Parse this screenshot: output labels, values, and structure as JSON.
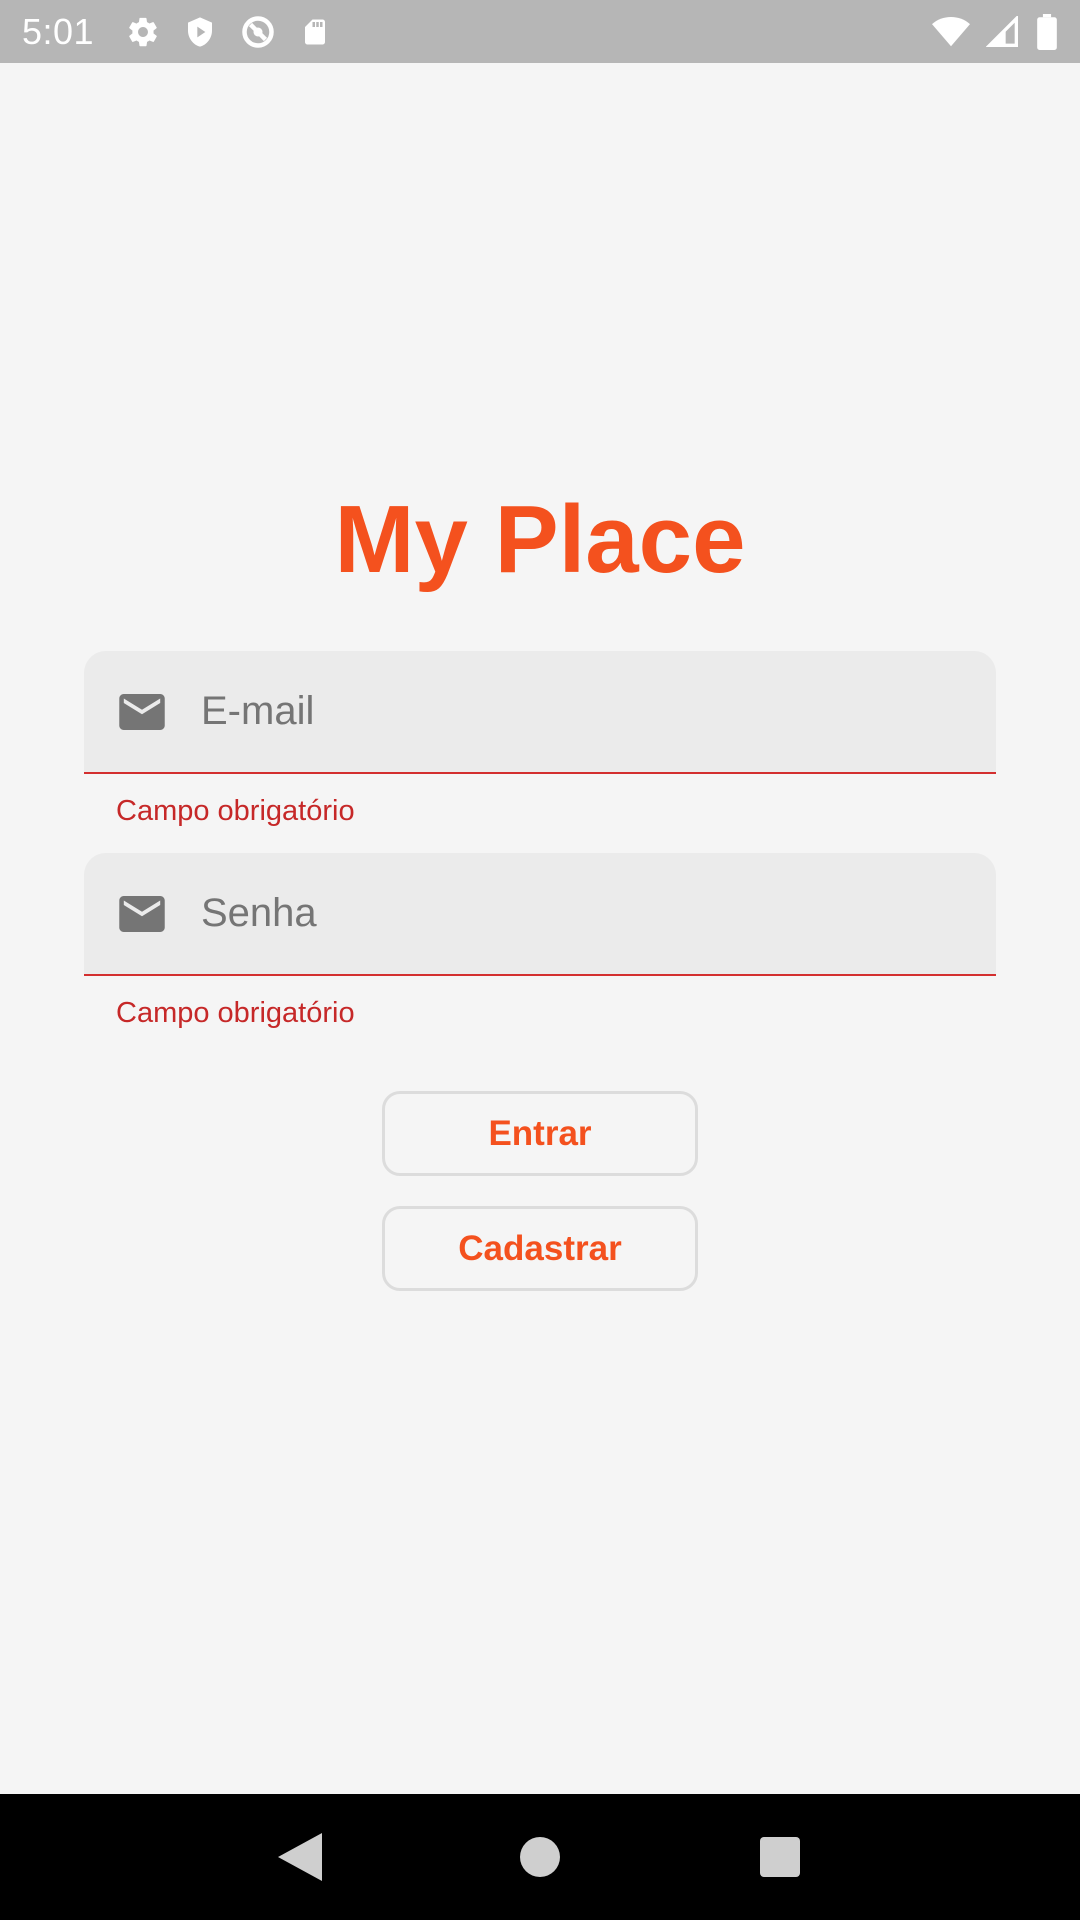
{
  "status_bar": {
    "time": "5:01",
    "left_icons": [
      "settings-icon",
      "shield-icon",
      "sync-off-icon",
      "sd-card-icon"
    ],
    "right_icons": [
      "wifi-icon",
      "cell-signal-icon",
      "battery-icon"
    ],
    "background": "#b6b6b6"
  },
  "app": {
    "title": "My Place",
    "accent_color": "#f4511e",
    "error_color": "#c62828"
  },
  "form": {
    "email": {
      "icon": "mail-icon",
      "placeholder": "E-mail",
      "value": "",
      "error": "Campo obrigatório"
    },
    "password": {
      "icon": "mail-icon",
      "placeholder": "Senha",
      "value": "",
      "error": "Campo obrigatório"
    },
    "login_button": "Entrar",
    "register_button": "Cadastrar"
  },
  "nav_bar": {
    "buttons": [
      "back-icon",
      "home-icon",
      "recents-icon"
    ]
  }
}
